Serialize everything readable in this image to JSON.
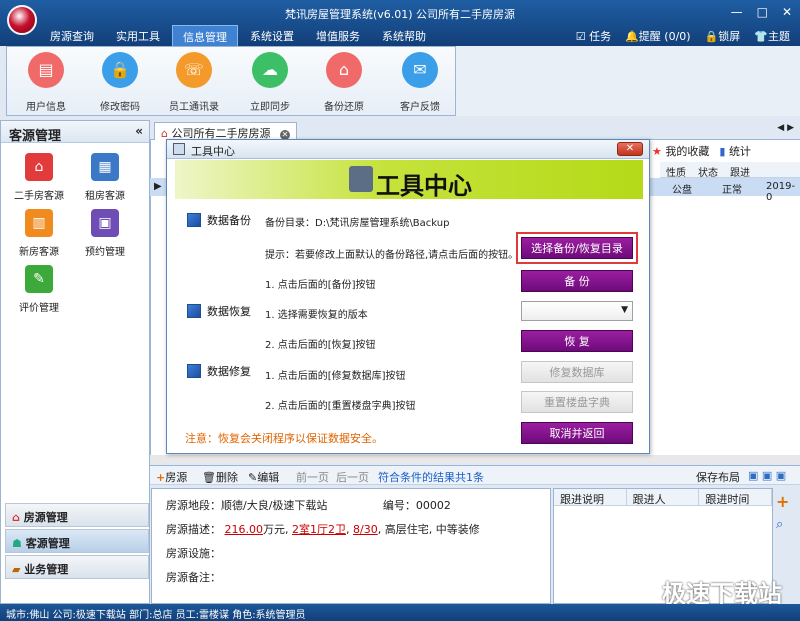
{
  "window": {
    "title": "梵讯房屋管理系统(v6.01) 公司所有二手房房源",
    "min": "—",
    "max": "□",
    "close": "✕"
  },
  "menu": [
    "房源查询",
    "实用工具",
    "信息管理",
    "系统设置",
    "增值服务",
    "系统帮助"
  ],
  "menu_active": 2,
  "top_right": {
    "task": "任务",
    "reminder": "提醒 (0/0)",
    "lock": "锁屏",
    "theme": "主题"
  },
  "ribbon": [
    {
      "label": "用户信息",
      "icon": "user-info-icon",
      "color": "#f06a6a"
    },
    {
      "label": "修改密码",
      "icon": "lock-icon",
      "color": "#3a9ee8"
    },
    {
      "label": "员工通讯录",
      "icon": "contacts-icon",
      "color": "#f49a2a"
    },
    {
      "label": "立即同步",
      "icon": "sync-cloud-icon",
      "color": "#3cbf67"
    },
    {
      "label": "备份还原",
      "icon": "backup-icon",
      "color": "#f06a6a"
    },
    {
      "label": "客户反馈",
      "icon": "feedback-icon",
      "color": "#3a9ee8"
    }
  ],
  "left": {
    "title": "客源管理",
    "items": [
      {
        "label": "二手房客源",
        "color": "#e23b3b"
      },
      {
        "label": "租房客源",
        "color": "#3b78c8"
      },
      {
        "label": "新房客源",
        "color": "#f08b1f"
      },
      {
        "label": "预约管理",
        "color": "#6e4db5"
      },
      {
        "label": "评价管理",
        "color": "#3da93b"
      }
    ],
    "nav": [
      "房源管理",
      "客源管理",
      "业务管理"
    ],
    "nav_selected": 1
  },
  "tab": {
    "label": "公司所有二手房房源"
  },
  "toolbar2": {
    "fav": "我的收藏",
    "stats": "统计"
  },
  "grid": {
    "headers": [
      "性质",
      "状态",
      "跟进"
    ],
    "row": {
      "nature": "公盘",
      "status": "正常",
      "date": "2019-0"
    }
  },
  "dialog": {
    "title": "工具中心",
    "banner": "工具中心",
    "backup": {
      "section": "数据备份",
      "dir": "备份目录：D:\\梵讯房屋管理系统\\Backup",
      "hint": "提示：若要修改上面默认的备份路径,请点击后面的按钮。",
      "choose_btn": "选择备份/恢复目录",
      "step1": "1. 点击后面的[备份]按钮",
      "backup_btn": "备 份"
    },
    "restore": {
      "section": "数据恢复",
      "step1": "1. 选择需要恢复的版本",
      "step2": "2. 点击后面的[恢复]按钮",
      "restore_btn": "恢 复"
    },
    "repair": {
      "section": "数据修复",
      "step1": "1. 点击后面的[修复数据库]按钮",
      "step2": "2. 点击后面的[重置楼盘字典]按钮",
      "repair_btn": "修复数据库",
      "reset_btn": "重置楼盘字典"
    },
    "note": "注意：恢复会关闭程序以保证数据安全。",
    "cancel_btn": "取消并返回"
  },
  "bottom_toolbar": {
    "add": "房源",
    "del": "删除",
    "edit": "编辑",
    "prev": "前一页",
    "next": "后一页",
    "result": "符合条件的结果共1条",
    "save_layout": "保存布局"
  },
  "detail": {
    "location_label": "房源地段：",
    "location": "顺德/大良/极速下载站",
    "id_label": "编号：",
    "id": "00002",
    "desc_label": "房源描述：",
    "price": "216.00",
    "price_unit": "万元,",
    "layout": "2室1厅2卫",
    "floor": "8/30",
    "desc_rest": "高层住宅, 中等装修",
    "facility_label": "房源设施：",
    "remark_label": "房源备注："
  },
  "follow": {
    "headers": [
      "跟进说明",
      "跟进人",
      "跟进时间"
    ]
  },
  "status": "城市:佛山  公司:极速下载站  部门:总店  员工:雷楼谋  角色:系统管理员",
  "watermark": "极速下载站"
}
